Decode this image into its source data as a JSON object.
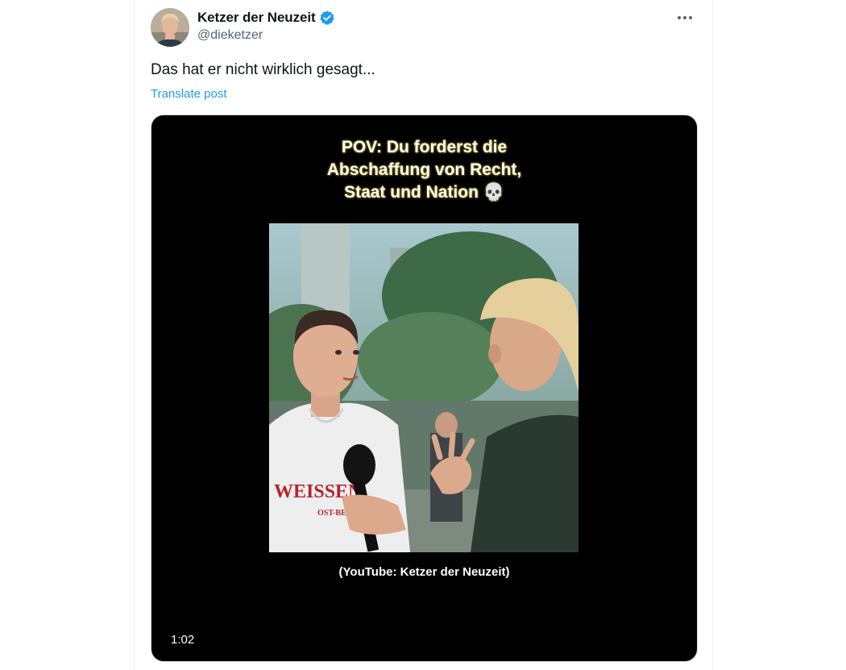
{
  "post": {
    "author": {
      "display_name": "Ketzer der Neuzeit",
      "handle": "@dieketzer",
      "verified": true,
      "avatar_icon": "person-avatar"
    },
    "more_icon": "more-dots-icon",
    "text": "Das hat er nicht wirklich gesagt...",
    "translate_label": "Translate post",
    "media": {
      "type": "video",
      "overlay_title_lines": [
        "POV: Du forderst die",
        "Abschaffung von Recht,",
        "Staat und Nation 💀"
      ],
      "shirt_text": "WEISSEN",
      "shirt_subtext": "OST-BERLIN",
      "credit": "(YouTube: Ketzer der Neuzeit)",
      "duration": "1:02"
    }
  },
  "colors": {
    "text_primary": "#0f1419",
    "text_secondary": "#536471",
    "link": "#1d9bf0",
    "verified_badge": "#1d9bf0",
    "media_bg": "#000000"
  }
}
